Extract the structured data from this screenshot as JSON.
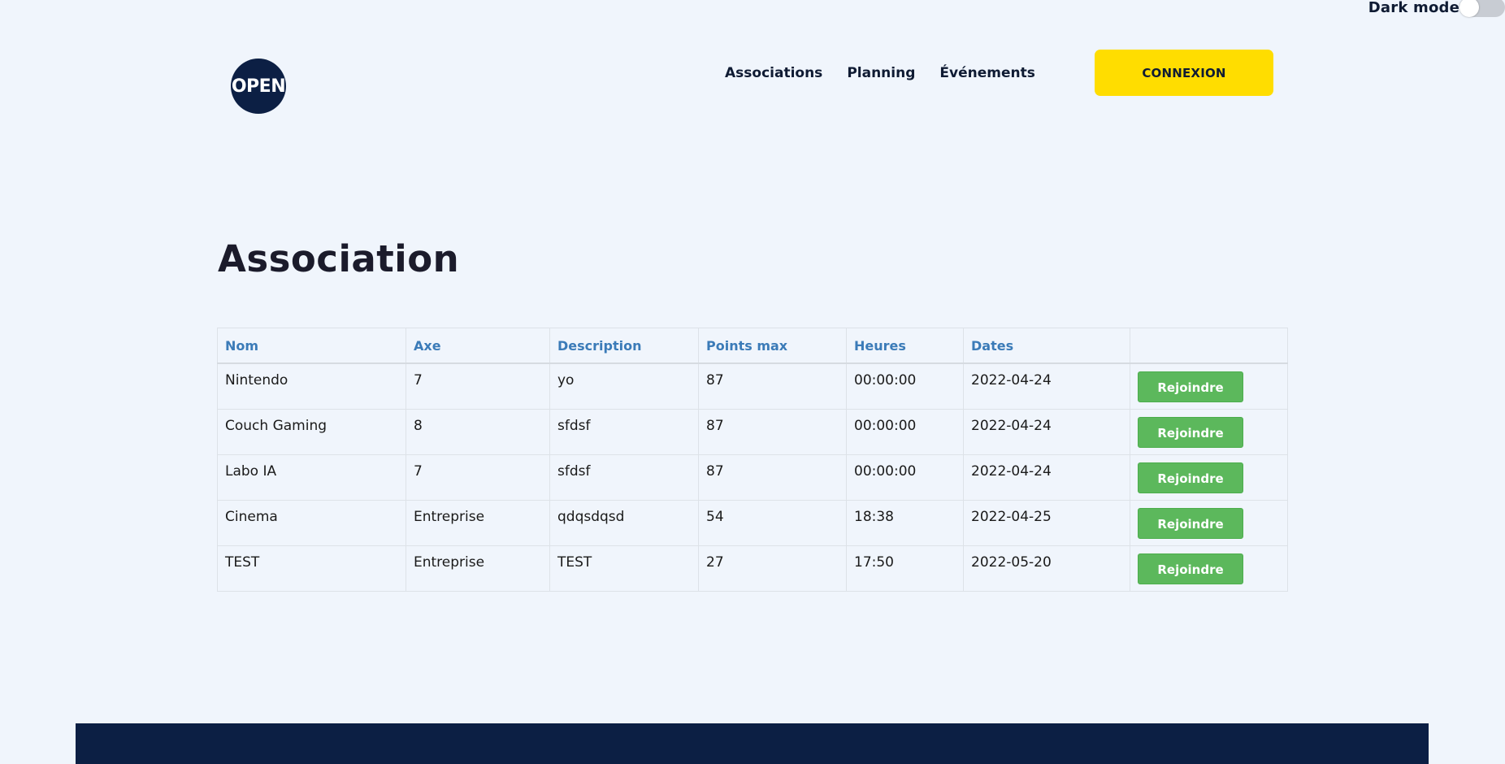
{
  "darkmode": {
    "label": "Dark mode",
    "enabled": false
  },
  "logo": {
    "text": "OPEN"
  },
  "nav": {
    "links": [
      "Associations",
      "Planning",
      "Événements"
    ],
    "login_label": "CONNEXION"
  },
  "colors": {
    "background": "#f0f5fc",
    "navy": "#0c1f44",
    "login_button": "#ffdd00",
    "join_button": "#5cb85c",
    "header_text": "#3b7bb8"
  },
  "page": {
    "title": "Association"
  },
  "table": {
    "headers": [
      "Nom",
      "Axe",
      "Description",
      "Points max",
      "Heures",
      "Dates",
      ""
    ],
    "rows": [
      {
        "nom": "Nintendo",
        "axe": "7",
        "description": "yo",
        "points": "87",
        "heures": "00:00:00",
        "dates": "2022-04-24",
        "action": "Rejoindre"
      },
      {
        "nom": "Couch Gaming",
        "axe": "8",
        "description": "sfdsf",
        "points": "87",
        "heures": "00:00:00",
        "dates": "2022-04-24",
        "action": "Rejoindre"
      },
      {
        "nom": "Labo IA",
        "axe": "7",
        "description": "sfdsf",
        "points": "87",
        "heures": "00:00:00",
        "dates": "2022-04-24",
        "action": "Rejoindre"
      },
      {
        "nom": "Cinema",
        "axe": "Entreprise",
        "description": "qdqsdqsd",
        "points": "54",
        "heures": "18:38",
        "dates": "2022-04-25",
        "action": "Rejoindre"
      },
      {
        "nom": "TEST",
        "axe": "Entreprise",
        "description": "TEST",
        "points": "27",
        "heures": "17:50",
        "dates": "2022-05-20",
        "action": "Rejoindre"
      }
    ]
  }
}
